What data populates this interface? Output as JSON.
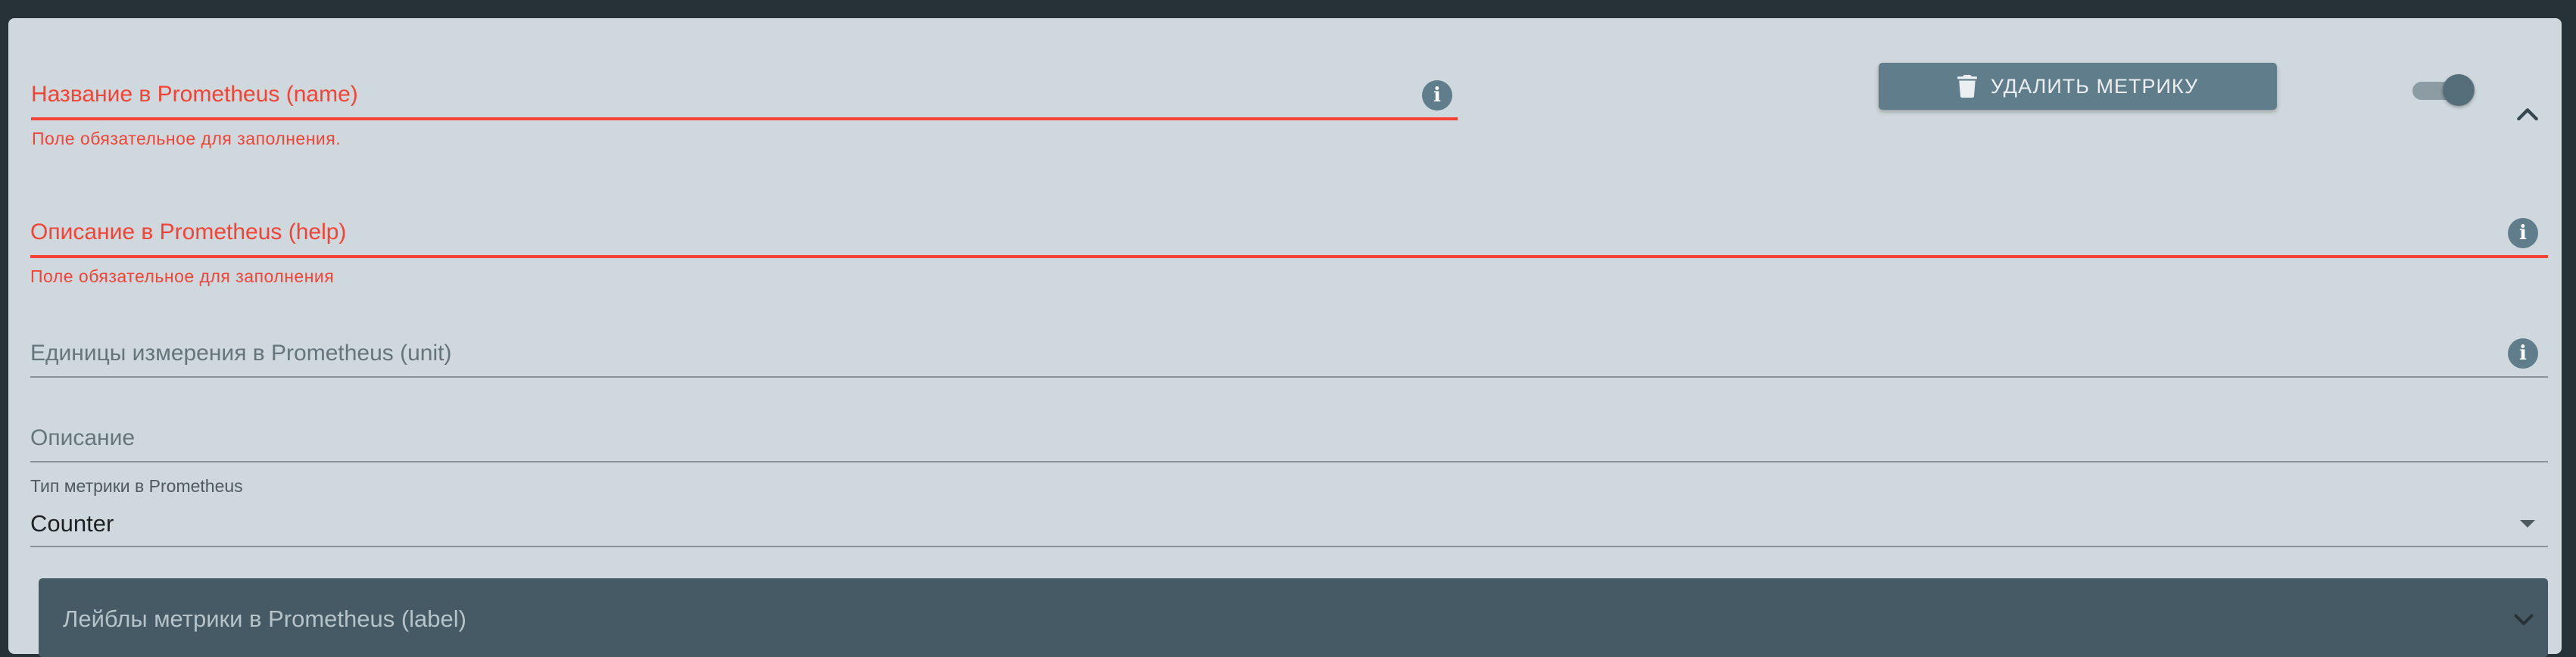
{
  "metric": {
    "name_field": {
      "placeholder": "Название в Prometheus (name)",
      "error": "Поле обязательное для заполнения."
    },
    "help_field": {
      "placeholder": "Описание в Prometheus (help)",
      "error": "Поле обязательное для заполнения"
    },
    "unit_field": {
      "placeholder": "Единицы измерения в Prometheus (unit)"
    },
    "description_field": {
      "placeholder": "Описание"
    },
    "type_select": {
      "label": "Тип метрики в Prometheus",
      "value": "Counter"
    },
    "labels_panel": {
      "title": "Лейблы метрики в Prometheus (label)"
    },
    "delete_button": {
      "label": "УДАЛИТЬ МЕТРИКУ",
      "icon": "trash-icon"
    },
    "enabled_toggle": {
      "on": true
    },
    "collapse_icon": "chevron-up-icon"
  },
  "icons": {
    "info": "i"
  },
  "colors": {
    "background": "#263238",
    "card": "#cfd8dc",
    "error": "#f44336",
    "accent": "#607d8b",
    "panel": "#455a64"
  }
}
